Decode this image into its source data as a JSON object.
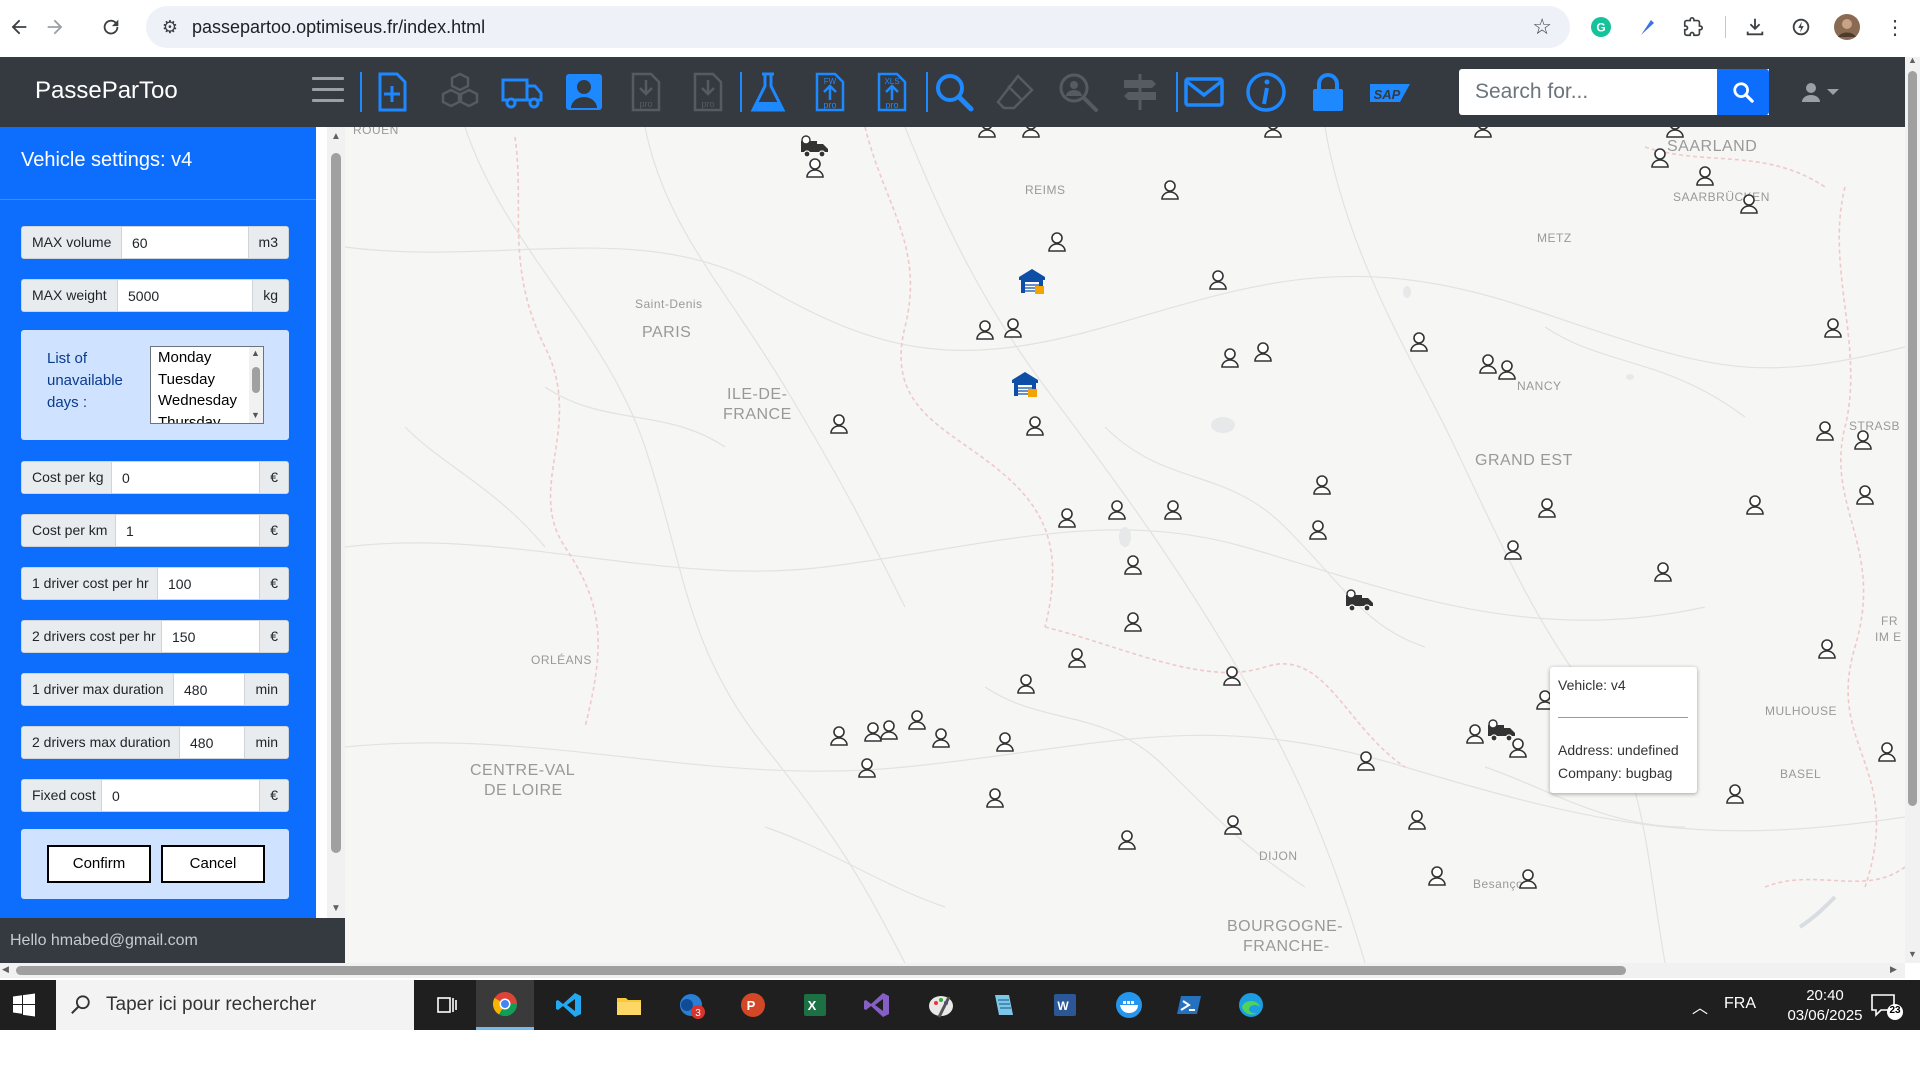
{
  "browser": {
    "url": "passepartoo.optimiseus.fr/index.html",
    "back_icon": "arrow-left-icon",
    "forward_icon": "arrow-right-icon",
    "reload_icon": "reload-icon"
  },
  "app": {
    "brand": "PasseParToo",
    "search_placeholder": "Search for...",
    "accent_color": "#0d6efd",
    "navbar_color": "#343a40",
    "toolbar_icons": [
      "new-document-icon",
      "cubes-icon",
      "truck-icon",
      "person-card-icon",
      "download-file-icon",
      "download-file-icon",
      "flask-icon",
      "upload-file-icon",
      "xls-file-icon",
      "search-icon",
      "eraser-icon",
      "search-user-icon",
      "signpost-icon",
      "envelope-icon",
      "info-icon",
      "lock-icon",
      "sap-icon"
    ],
    "toolbar_labels": {
      "pro": "pro",
      "sap": "SAP",
      "xls": "XLS",
      "fw": "FW"
    }
  },
  "panel": {
    "title": "Vehicle settings: v4",
    "fields": [
      {
        "label": "MAX volume",
        "value": "60",
        "unit": "m3"
      },
      {
        "label": "MAX weight",
        "value": "5000",
        "unit": "kg"
      },
      {
        "label": "Cost per kg",
        "value": "0",
        "unit": "€"
      },
      {
        "label": "Cost per km",
        "value": "1",
        "unit": "€"
      },
      {
        "label": "1 driver cost per hr",
        "value": "100",
        "unit": "€"
      },
      {
        "label": "2 drivers cost per hr",
        "value": "150",
        "unit": "€"
      },
      {
        "label": "1 driver max duration",
        "value": "480",
        "unit": "min"
      },
      {
        "label": "2 drivers max duration",
        "value": "480",
        "unit": "min"
      },
      {
        "label": "Fixed cost",
        "value": "0",
        "unit": "€"
      }
    ],
    "days_label": "List of unavailable days :",
    "days": [
      "Monday",
      "Tuesday",
      "Wednesday",
      "Thursday"
    ],
    "confirm": "Confirm",
    "cancel": "Cancel"
  },
  "footer": {
    "hello": "Hello hmabed@gmail.com"
  },
  "map": {
    "labels": [
      {
        "text": "ROUEN",
        "cls": "small"
      },
      {
        "text": "REIMS",
        "cls": "small"
      },
      {
        "text": "SAARLAND",
        "cls": "big"
      },
      {
        "text": "SAARBRÜCKEN",
        "cls": "small"
      },
      {
        "text": "METZ",
        "cls": "small"
      },
      {
        "text": "Saint-Denis",
        "cls": "small"
      },
      {
        "text": "PARIS",
        "cls": "big"
      },
      {
        "text": "ILE-DE-",
        "cls": "big"
      },
      {
        "text": "FRANCE",
        "cls": "big"
      },
      {
        "text": "NANCY",
        "cls": "small"
      },
      {
        "text": "GRAND EST",
        "cls": "big"
      },
      {
        "text": "STRASB",
        "cls": "small"
      },
      {
        "text": "ORLÉANS",
        "cls": "small"
      },
      {
        "text": "CENTRE-VAL",
        "cls": "big"
      },
      {
        "text": "DE LOIRE",
        "cls": "big"
      },
      {
        "text": "MULHOUSE",
        "cls": "small"
      },
      {
        "text": "BASEL",
        "cls": "small"
      },
      {
        "text": "DIJON",
        "cls": "small"
      },
      {
        "text": "Besançon",
        "cls": "small"
      },
      {
        "text": "BOURGOGNE-",
        "cls": "big"
      },
      {
        "text": "FRANCHE-",
        "cls": "big"
      },
      {
        "text": "FR",
        "cls": "small"
      },
      {
        "text": "IM E",
        "cls": "small"
      }
    ],
    "popup": {
      "vehicle": "Vehicle: v4",
      "address": "Address: undefined",
      "company": "Company: bugbag"
    }
  },
  "taskbar": {
    "search_placeholder": "Taper ici pour rechercher",
    "apps": [
      "task-view-icon",
      "chrome-icon",
      "vscode-icon",
      "file-explorer-icon",
      "outlook-icon",
      "powerpoint-icon",
      "excel-icon",
      "visual-studio-icon",
      "paint-icon",
      "notepad-icon",
      "word-icon",
      "docker-icon",
      "powershell-icon",
      "edge-icon"
    ],
    "outlook_badge": "3",
    "lang": "FRA",
    "time": "20:40",
    "date": "03/06/2025",
    "notifications": "23"
  }
}
